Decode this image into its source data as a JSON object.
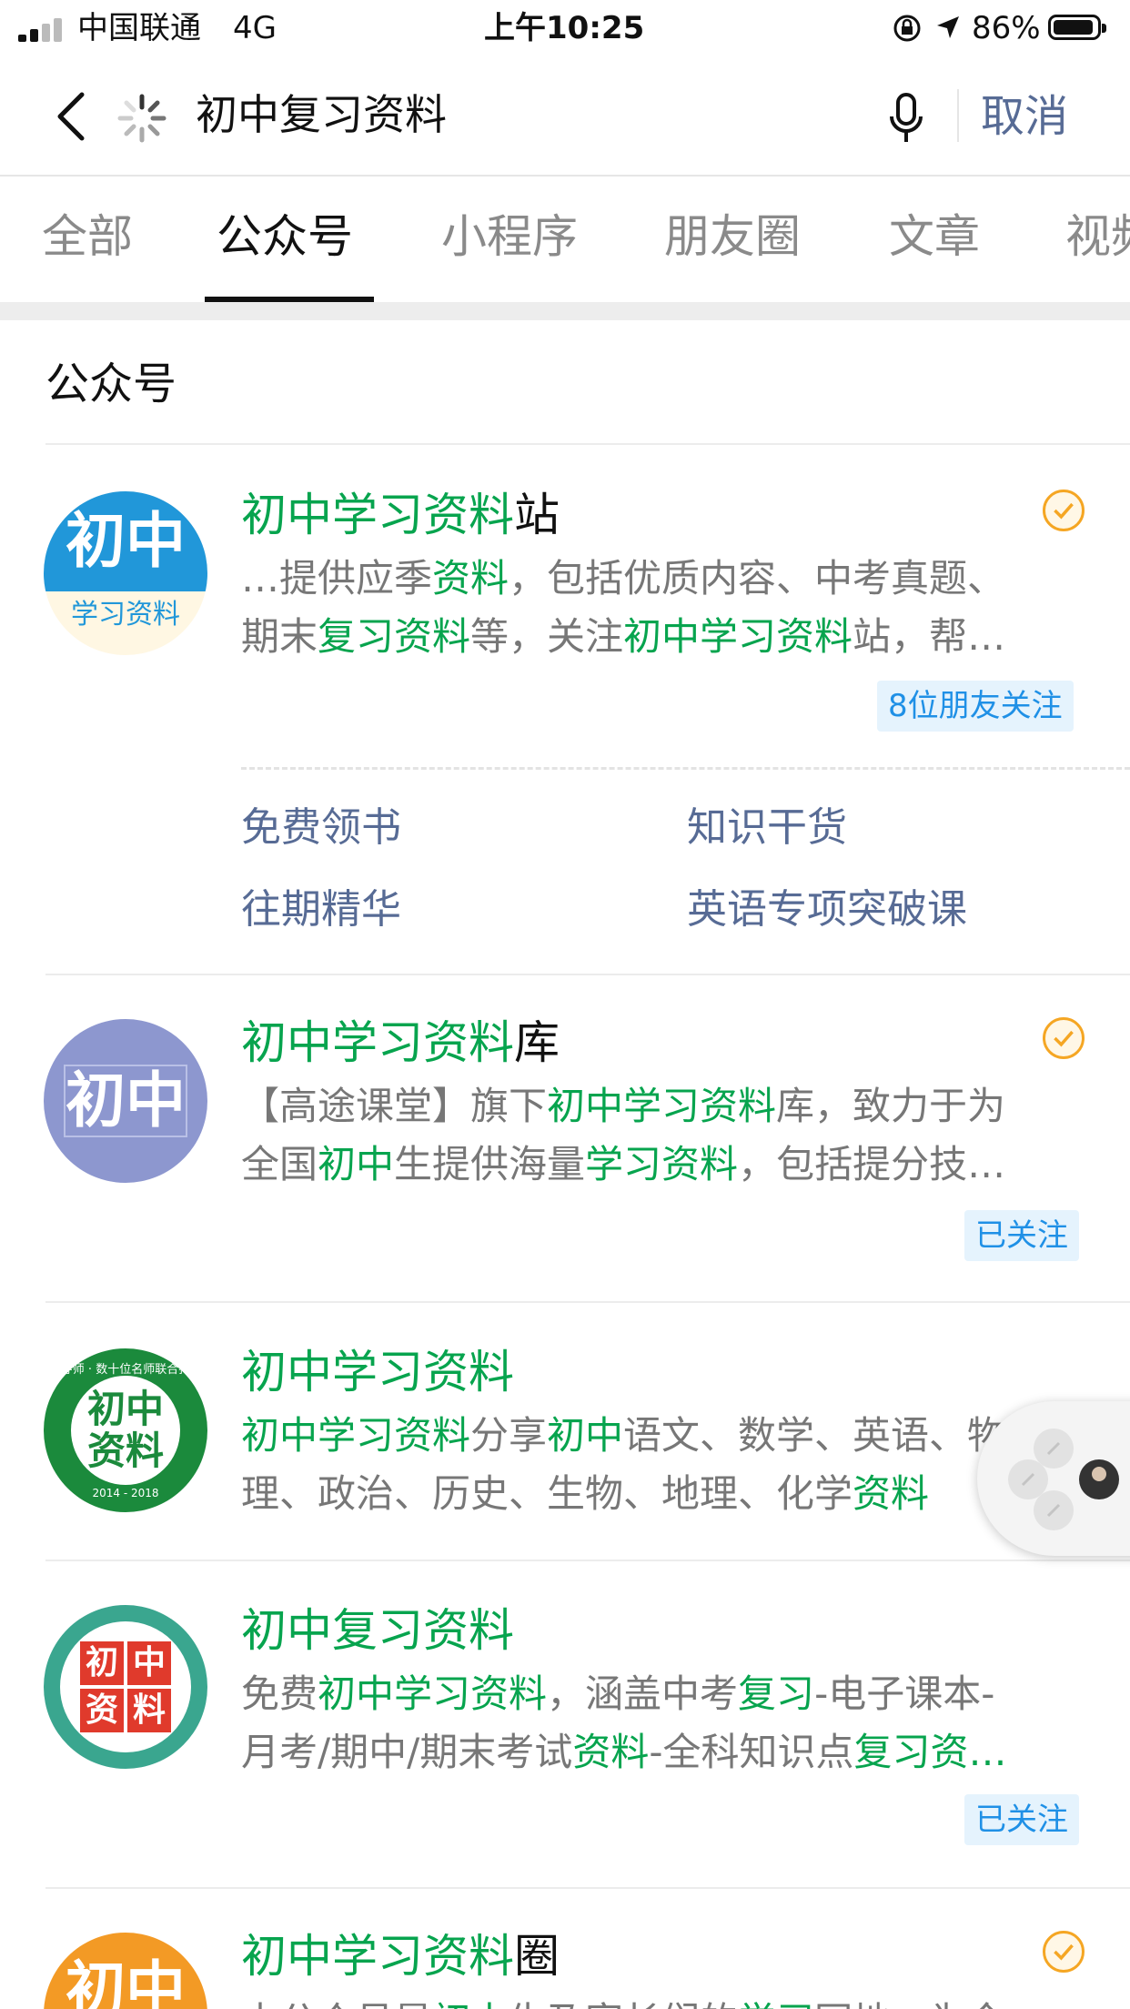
{
  "status_bar": {
    "carrier": "中国联通",
    "network": "4G",
    "time": "上午10:25",
    "battery": "86%"
  },
  "search": {
    "query": "初中复习资料",
    "cancel_label": "取消"
  },
  "tabs": [
    "全部",
    "公众号",
    "小程序",
    "朋友圈",
    "文章",
    "视频"
  ],
  "section_title": "公众号",
  "accounts": [
    {
      "name_hl": "初中学习资料",
      "name_rest": "站",
      "desc1": [
        [
          "…提供应季",
          0
        ],
        [
          "资料",
          1
        ],
        [
          "，包括优质内容、中考真题、",
          0
        ]
      ],
      "desc2": [
        [
          "期末",
          0
        ],
        [
          "复习资料",
          1
        ],
        [
          "等，关注",
          0
        ],
        [
          "初中学习资料",
          1
        ],
        [
          "站，帮…",
          0
        ]
      ],
      "badge": "8位朋友关注",
      "avatar_text_top": "初中",
      "avatar_text_bottom": "学习资料",
      "menu": [
        "免费领书",
        "知识干货",
        "往期精华",
        "英语专项突破课"
      ]
    },
    {
      "name_hl": "初中学习资料",
      "name_rest": "库",
      "desc1": [
        [
          "【高途课堂】旗下",
          0
        ],
        [
          "初中学习资料",
          1
        ],
        [
          "库，致力于为",
          0
        ]
      ],
      "desc2": [
        [
          "全国",
          0
        ],
        [
          "初中",
          1
        ],
        [
          "生提供海量",
          0
        ],
        [
          "学习资料",
          1
        ],
        [
          "，包括提分技…",
          0
        ]
      ],
      "badge": "已关注",
      "avatar_text": "初中"
    },
    {
      "name_hl": "初中学习资料",
      "name_rest": "",
      "desc1": [
        [
          "初中学习资料",
          1
        ],
        [
          "分享",
          0
        ],
        [
          "初中",
          1
        ],
        [
          "语文、数学、英语、物",
          0
        ]
      ],
      "desc2": [
        [
          "理、政治、历史、生物、地理、化学",
          0
        ],
        [
          "资料",
          1
        ]
      ],
      "avatar_ring_text": "聚导师 · 数十位名师联合打造",
      "avatar_center": [
        "初中",
        "资料"
      ],
      "avatar_years": "2014 - 2018"
    },
    {
      "name_hl": "初中复习资料",
      "name_rest": "",
      "desc1": [
        [
          "免费",
          0
        ],
        [
          "初中学习资料",
          1
        ],
        [
          "，涵盖中考",
          0
        ],
        [
          "复习",
          1
        ],
        [
          "-电子课本-",
          0
        ]
      ],
      "desc2": [
        [
          "月考/期中/期末考试",
          0
        ],
        [
          "资料",
          1
        ],
        [
          "-全科知识点",
          0
        ],
        [
          "复习资…",
          1
        ]
      ],
      "badge": "已关注",
      "avatar_tiles": [
        "初",
        "中",
        "资",
        "料"
      ]
    },
    {
      "name_hl": "初中学习资料",
      "name_rest": "圈",
      "desc1": [
        [
          "本公众号是",
          0
        ],
        [
          "初中",
          1
        ],
        [
          "生及家长们的",
          0
        ],
        [
          "学习",
          1
        ],
        [
          "园地，为今…",
          0
        ]
      ],
      "avatar_text": "初中"
    }
  ],
  "colors": {
    "highlight": "#07a44e",
    "link": "#576b95",
    "badge_text": "#1f90e6",
    "badge_bg": "#e5f3fd",
    "verify": "#f5a623"
  },
  "icons": [
    "signal-icon",
    "location-arrow-icon",
    "rotation-lock-icon",
    "battery-icon",
    "back-chevron-icon",
    "loading-spinner-icon",
    "microphone-icon",
    "verified-icon",
    "link-icon"
  ]
}
